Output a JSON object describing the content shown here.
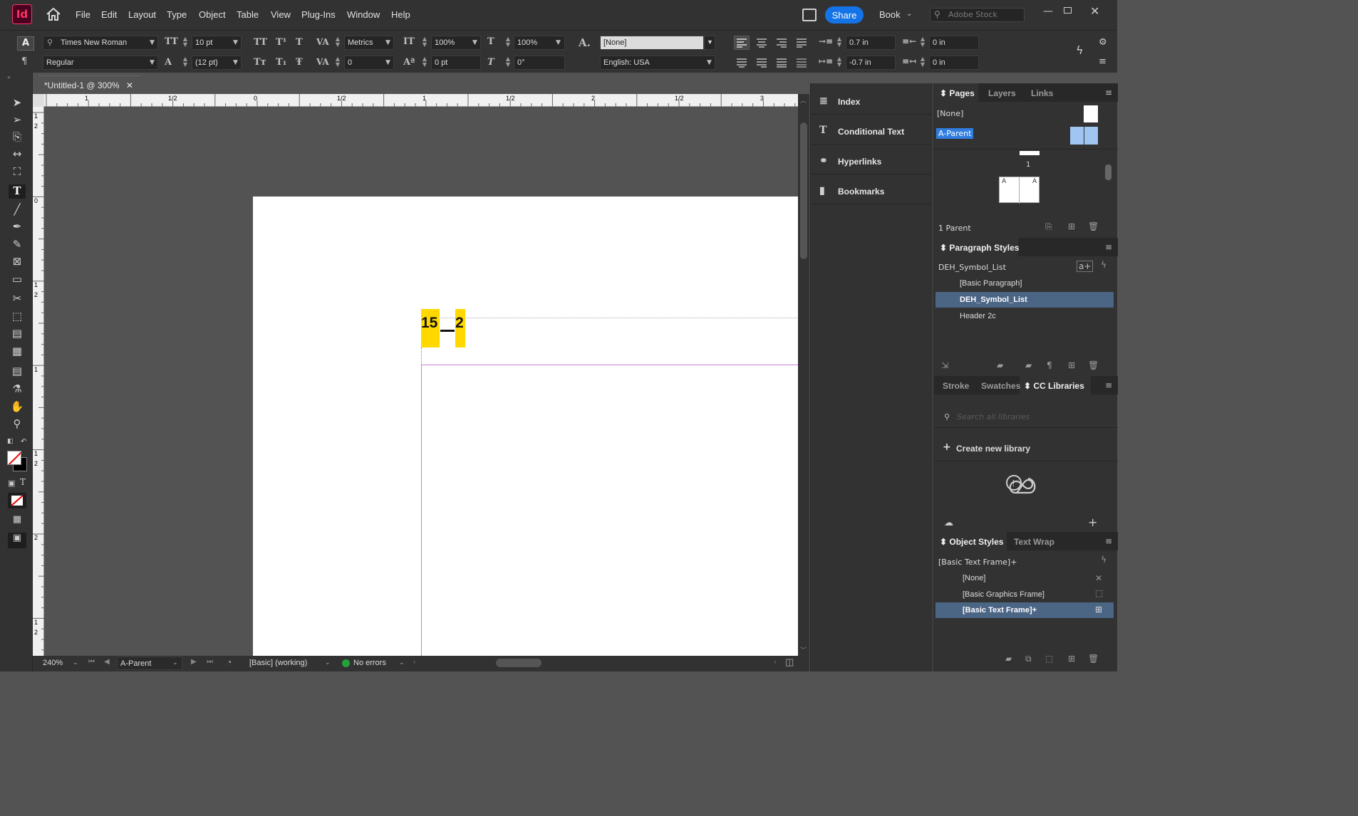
{
  "app": {
    "logo": "Id"
  },
  "menu": [
    "File",
    "Edit",
    "Layout",
    "Type",
    "Object",
    "Table",
    "View",
    "Plug-Ins",
    "Window",
    "Help"
  ],
  "topright": {
    "share": "Share",
    "workspace": "Book",
    "stock_placeholder": "Adobe Stock"
  },
  "control": {
    "font_family": "Times New Roman",
    "font_style": "Regular",
    "font_size": "10 pt",
    "leading": "(12 pt)",
    "kerning": "Metrics",
    "tracking": "0",
    "vscale": "100%",
    "hscale": "100%",
    "baseline": "0 pt",
    "skew": "0°",
    "char_style": "[None]",
    "language": "English: USA",
    "left_indent": "0.7 in",
    "first_indent": "-0.7 in",
    "right_indent": "0 in",
    "last_indent": "0 in"
  },
  "document": {
    "tab_title": "*Untitled-1 @ 300%",
    "frame_text_a": "15",
    "frame_text_b": "2"
  },
  "ruler_top": [
    "1",
    "1/2",
    "0",
    "1/2",
    "1",
    "1/2",
    "2",
    "1/2",
    "3"
  ],
  "ruler_left": [
    "1",
    "2",
    "0",
    "1",
    "2",
    "1",
    "1",
    "2",
    "2",
    "1",
    "2"
  ],
  "status": {
    "zoom": "240%",
    "page": "A-Parent",
    "preflight_profile": "[Basic] (working)",
    "errors": "No errors"
  },
  "mid_panels": [
    "Index",
    "Conditional Text",
    "Hyperlinks",
    "Bookmarks"
  ],
  "pages_panel": {
    "tabs": [
      "Pages",
      "Layers",
      "Links"
    ],
    "parents": [
      "[None]",
      "A-Parent"
    ],
    "page_number": "1",
    "thumb_label": "A",
    "footer": "1 Parent"
  },
  "paragraph_styles": {
    "tab": "Paragraph Styles",
    "current": "DEH_Symbol_List",
    "items": [
      "[Basic Paragraph]",
      "DEH_Symbol_List",
      "Header 2c"
    ],
    "selected": 1
  },
  "libraries": {
    "tabs": [
      "Stroke",
      "Swatches",
      "CC Libraries"
    ],
    "search_placeholder": "Search all libraries",
    "create": "Create new library"
  },
  "object_styles": {
    "tabs": [
      "Object Styles",
      "Text Wrap"
    ],
    "current": "[Basic Text Frame]+",
    "items": [
      "[None]",
      "[Basic Graphics Frame]",
      "[Basic Text Frame]+"
    ],
    "selected": 2
  },
  "colors": {
    "accent": "#1473e6",
    "selection": "#4b6585",
    "highlight": "#ffd800",
    "parent_blue": "#9fc5f0"
  }
}
